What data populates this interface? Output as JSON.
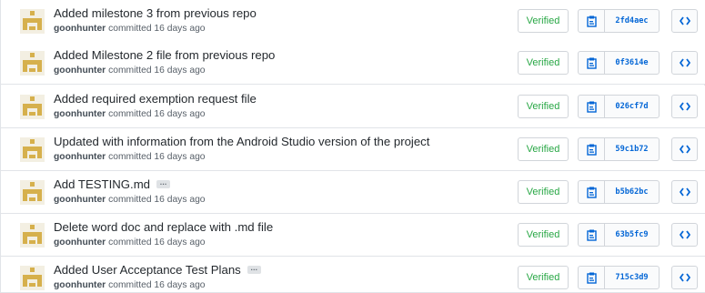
{
  "commits": [
    {
      "title": "Added milestone 3 from previous repo",
      "has_ellipsis": false,
      "author": "goonhunter",
      "meta": " committed 16 days ago",
      "verified": "Verified",
      "sha": "2fd4aec"
    },
    {
      "title": "Added Milestone 2 file from previous repo",
      "has_ellipsis": false,
      "author": "goonhunter",
      "meta": " committed 16 days ago",
      "verified": "Verified",
      "sha": "0f3614e"
    },
    {
      "title": "Added required exemption request file",
      "has_ellipsis": false,
      "author": "goonhunter",
      "meta": " committed 16 days ago",
      "verified": "Verified",
      "sha": "026cf7d"
    },
    {
      "title": "Updated with information from the Android Studio version of the project",
      "has_ellipsis": false,
      "author": "goonhunter",
      "meta": " committed 16 days ago",
      "verified": "Verified",
      "sha": "59c1b72"
    },
    {
      "title": "Add TESTING.md",
      "has_ellipsis": true,
      "author": "goonhunter",
      "meta": " committed 16 days ago",
      "verified": "Verified",
      "sha": "b5b62bc"
    },
    {
      "title": "Delete word doc and replace with .md file",
      "has_ellipsis": false,
      "author": "goonhunter",
      "meta": " committed 16 days ago",
      "verified": "Verified",
      "sha": "63b5fc9"
    },
    {
      "title": "Added User Acceptance Test Plans",
      "has_ellipsis": true,
      "author": "goonhunter",
      "meta": " committed 16 days ago",
      "verified": "Verified",
      "sha": "715c3d9"
    }
  ],
  "icons": {
    "avatar": "identicon-avatar",
    "clipboard": "clipboard-icon",
    "browse": "code-brackets-icon",
    "ellipsis": "ellipsis-icon"
  },
  "colors": {
    "avatar": "#e8c86a",
    "avatar_inner": "#c9a23f",
    "verified": "#28a745",
    "sha": "#0366d6",
    "clipboard": "#0366d6"
  },
  "ellipsis_text": "…"
}
